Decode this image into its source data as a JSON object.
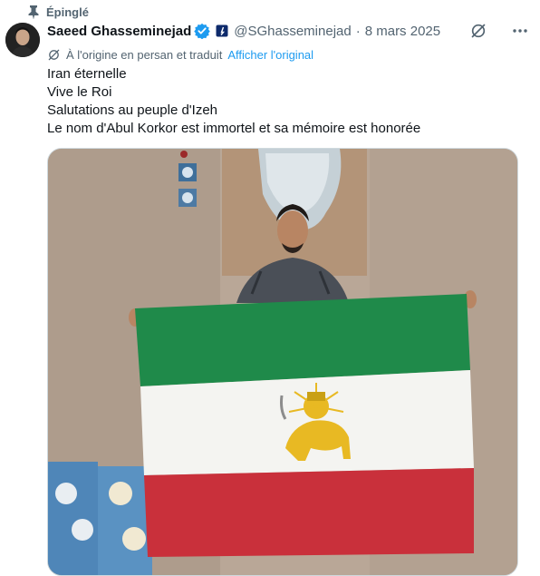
{
  "pinned": {
    "label": "Épinglé",
    "icon": "pin-icon"
  },
  "author": {
    "display_name": "Saeed Ghasseminejad",
    "handle": "@SGhasseminejad",
    "separator": "·",
    "date": "8 mars 2025",
    "verified_color": "#1d9bf0"
  },
  "translation": {
    "note": "À l'origine en persan et traduit",
    "link_label": "Afficher l'original"
  },
  "tweet_lines": [
    "Iran éternelle",
    "Vive le Roi",
    "Salutations au peuple d'Izeh",
    "Le nom d'Abul Korkor est immortel et sa mémoire est honorée"
  ],
  "media": {
    "alt": "",
    "flag_colors": {
      "green": "#1f8a4a",
      "white": "#f4f4f1",
      "red": "#c9303b",
      "emblem": "#e8b923"
    }
  },
  "colors": {
    "accent": "#1d9bf0",
    "secondary_text": "#536471",
    "text": "#0f1419"
  }
}
